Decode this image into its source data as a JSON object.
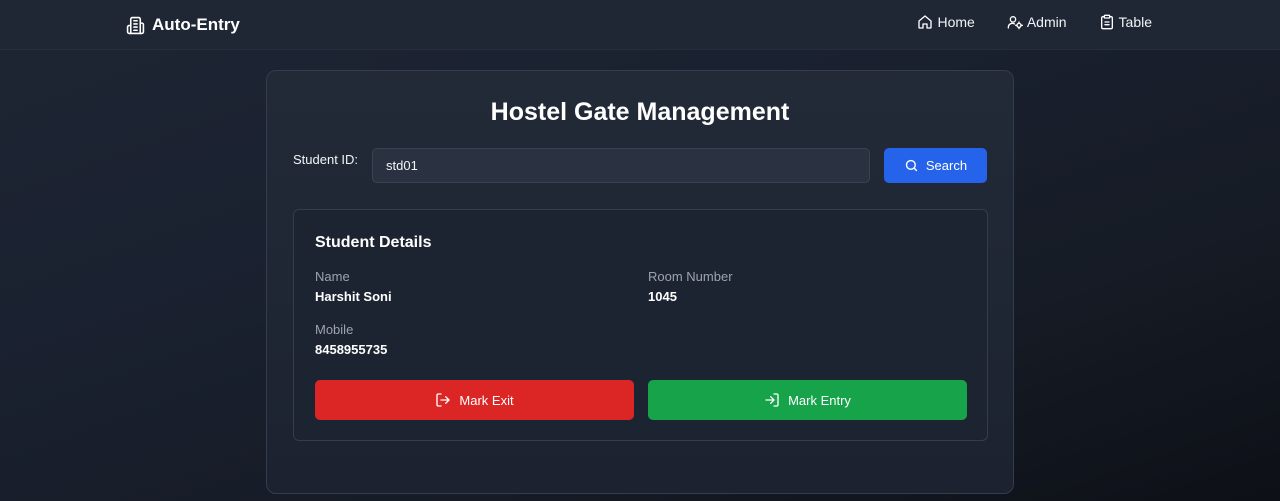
{
  "navbar": {
    "brand": "Auto-Entry",
    "links": [
      {
        "label": "Home",
        "icon": "home-icon"
      },
      {
        "label": "Admin",
        "icon": "user-cog-icon"
      },
      {
        "label": "Table",
        "icon": "clipboard-icon"
      }
    ]
  },
  "main": {
    "title": "Hostel Gate Management",
    "student_id_label": "Student ID:",
    "student_id_value": "std01",
    "search_label": "Search",
    "details": {
      "title": "Student Details",
      "name_label": "Name",
      "name_value": "Harshit Soni",
      "room_label": "Room Number",
      "room_value": "1045",
      "mobile_label": "Mobile",
      "mobile_value": "8458955735"
    },
    "exit_label": "Mark Exit",
    "entry_label": "Mark Entry"
  },
  "colors": {
    "primary": "#2563eb",
    "danger": "#dc2626",
    "success": "#16a34a",
    "background": "#1a2130"
  }
}
